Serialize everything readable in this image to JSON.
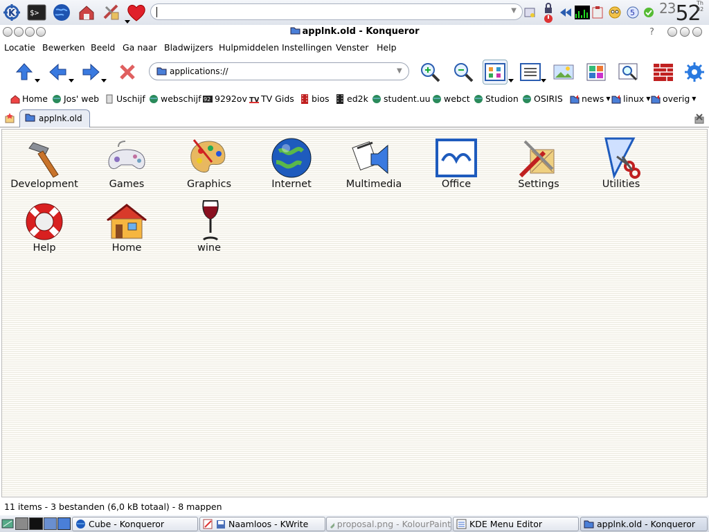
{
  "panel": {
    "command_value": "",
    "clock": {
      "time": "23:52",
      "time_hours": "23",
      "time_minutes": "52",
      "day": "Th 02"
    }
  },
  "window": {
    "title": "applnk.old - Konqueror",
    "help_glyph": "?"
  },
  "menu": {
    "items": [
      "Locatie",
      "Bewerken",
      "Beeld",
      "Ga naar",
      "Bladwijzers",
      "Hulpmiddelen",
      "Instellingen",
      "Venster",
      "Help"
    ]
  },
  "location": {
    "url": "applications://"
  },
  "bookmarks": {
    "items": [
      "Home",
      "Jos' web",
      "Uschijf",
      "webschijf",
      "9292ov",
      "TV Gids",
      "bios",
      "ed2k",
      "student.uu",
      "webct",
      "Studion",
      "OSIRIS",
      "news",
      "linux",
      "overig"
    ]
  },
  "tabs": {
    "active": "applnk.old"
  },
  "items": {
    "labels": [
      "Development",
      "Games",
      "Graphics",
      "Internet",
      "Multimedia",
      "Office",
      "Settings",
      "Utilities",
      "Help",
      "Home",
      "wine"
    ]
  },
  "status": {
    "text": "11 items - 3 bestanden (6,0 kB totaal) - 8 mappen"
  },
  "taskbar": {
    "tasks": [
      "Cube - Konqueror",
      "Naamloos - KWrite",
      "proposal.png - KolourPaint",
      "KDE Menu Editor",
      "applnk.old - Konqueror"
    ]
  },
  "colors": {
    "accent": "#2a5db0",
    "folder": "#4a7fd8",
    "close_red": "#d03030"
  }
}
